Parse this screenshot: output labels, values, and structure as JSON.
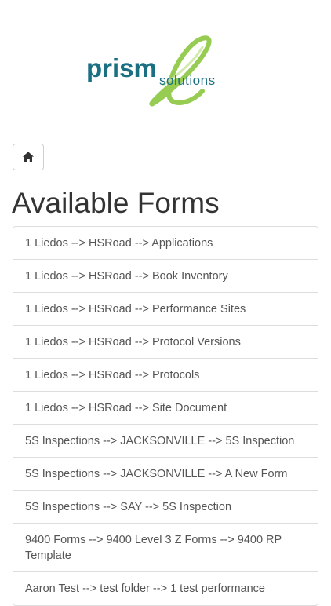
{
  "header": {
    "logo_text_main": "prism",
    "logo_text_sub": "solutions",
    "logo_letter": "e"
  },
  "nav": {
    "home_icon": "home-icon"
  },
  "page": {
    "title": "Available Forms"
  },
  "forms": [
    "1 Liedos --> HSRoad --> Applications",
    "1 Liedos --> HSRoad --> Book Inventory",
    "1 Liedos --> HSRoad --> Performance Sites",
    "1 Liedos --> HSRoad --> Protocol Versions",
    "1 Liedos --> HSRoad --> Protocols",
    "1 Liedos --> HSRoad --> Site Document",
    "5S Inspections --> JACKSONVILLE --> 5S Inspection",
    "5S Inspections --> JACKSONVILLE --> A New Form",
    "5S Inspections --> SAY --> 5S Inspection",
    "9400 Forms --> 9400 Level 3 Z Forms --> 9400 RP Template",
    "Aaron Test --> test folder --> 1 test performance"
  ],
  "colors": {
    "brand_teal": "#1a6f82",
    "brand_green": "#8cc63f",
    "text": "#333333",
    "list_text": "#555555",
    "border": "#dddddd"
  }
}
